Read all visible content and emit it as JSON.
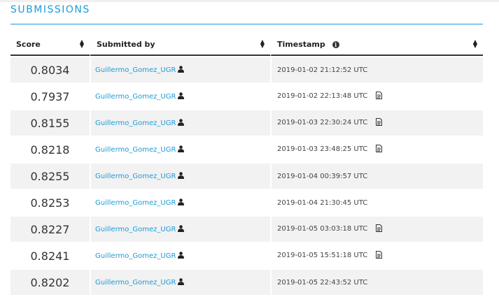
{
  "section": {
    "title": "SUBMISSIONS"
  },
  "table": {
    "headers": {
      "score": "Score",
      "submitted_by": "Submitted by",
      "timestamp": "Timestamp"
    },
    "rows": [
      {
        "score": "0.8034",
        "user": "Guillermo_Gomez_UGR",
        "timestamp": "2019-01-02 21:12:52 UTC",
        "has_doc": false
      },
      {
        "score": "0.7937",
        "user": "Guillermo_Gomez_UGR",
        "timestamp": "2019-01-02 22:13:48 UTC",
        "has_doc": true
      },
      {
        "score": "0.8155",
        "user": "Guillermo_Gomez_UGR",
        "timestamp": "2019-01-03 22:30:24 UTC",
        "has_doc": true
      },
      {
        "score": "0.8218",
        "user": "Guillermo_Gomez_UGR",
        "timestamp": "2019-01-03 23:48:25 UTC",
        "has_doc": true
      },
      {
        "score": "0.8255",
        "user": "Guillermo_Gomez_UGR",
        "timestamp": "2019-01-04 00:39:57 UTC",
        "has_doc": false
      },
      {
        "score": "0.8253",
        "user": "Guillermo_Gomez_UGR",
        "timestamp": "2019-01-04 21:30:45 UTC",
        "has_doc": false
      },
      {
        "score": "0.8227",
        "user": "Guillermo_Gomez_UGR",
        "timestamp": "2019-01-05 03:03:18 UTC",
        "has_doc": true
      },
      {
        "score": "0.8241",
        "user": "Guillermo_Gomez_UGR",
        "timestamp": "2019-01-05 15:51:18 UTC",
        "has_doc": true
      },
      {
        "score": "0.8202",
        "user": "Guillermo_Gomez_UGR",
        "timestamp": "2019-01-05 22:43:52 UTC",
        "has_doc": false
      }
    ]
  },
  "colors": {
    "accent": "#1a9bd7",
    "row_stripe": "#f2f2f2"
  },
  "icons": {
    "sort": "sort-icon",
    "info": "info-icon",
    "user": "person-icon",
    "doc": "document-icon"
  }
}
